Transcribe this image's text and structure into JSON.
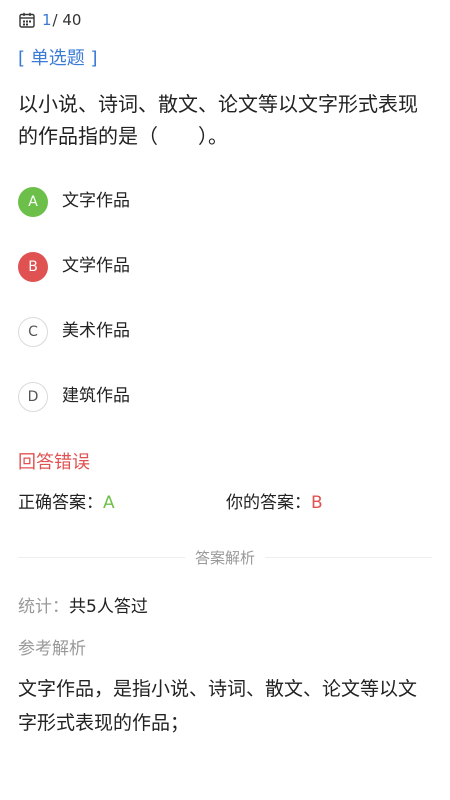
{
  "progress": {
    "current": "1",
    "total": "/ 40"
  },
  "question": {
    "type": "[ 单选题 ]",
    "text": "以小说、诗词、散文、论文等以文字形式表现的作品指的是（　　）。"
  },
  "options": [
    {
      "letter": "A",
      "label": "文字作品",
      "state": "correct"
    },
    {
      "letter": "B",
      "label": "文学作品",
      "state": "wrong"
    },
    {
      "letter": "C",
      "label": "美术作品",
      "state": "plain"
    },
    {
      "letter": "D",
      "label": "建筑作品",
      "state": "plain"
    }
  ],
  "result": {
    "text": "回答错误",
    "correct_label": "正确答案：",
    "correct_value": "A",
    "mine_label": "你的答案：",
    "mine_value": "B"
  },
  "analysis": {
    "divider": "答案解析",
    "stats_label": "统计：",
    "stats_value": "共5人答过",
    "ref_label": "参考解析",
    "text": "文字作品，是指小说、诗词、散文、论文等以文字形式表现的作品；"
  },
  "colors": {
    "accent": "#3a7bd5",
    "correct": "#6cc04a",
    "wrong": "#e05252"
  }
}
